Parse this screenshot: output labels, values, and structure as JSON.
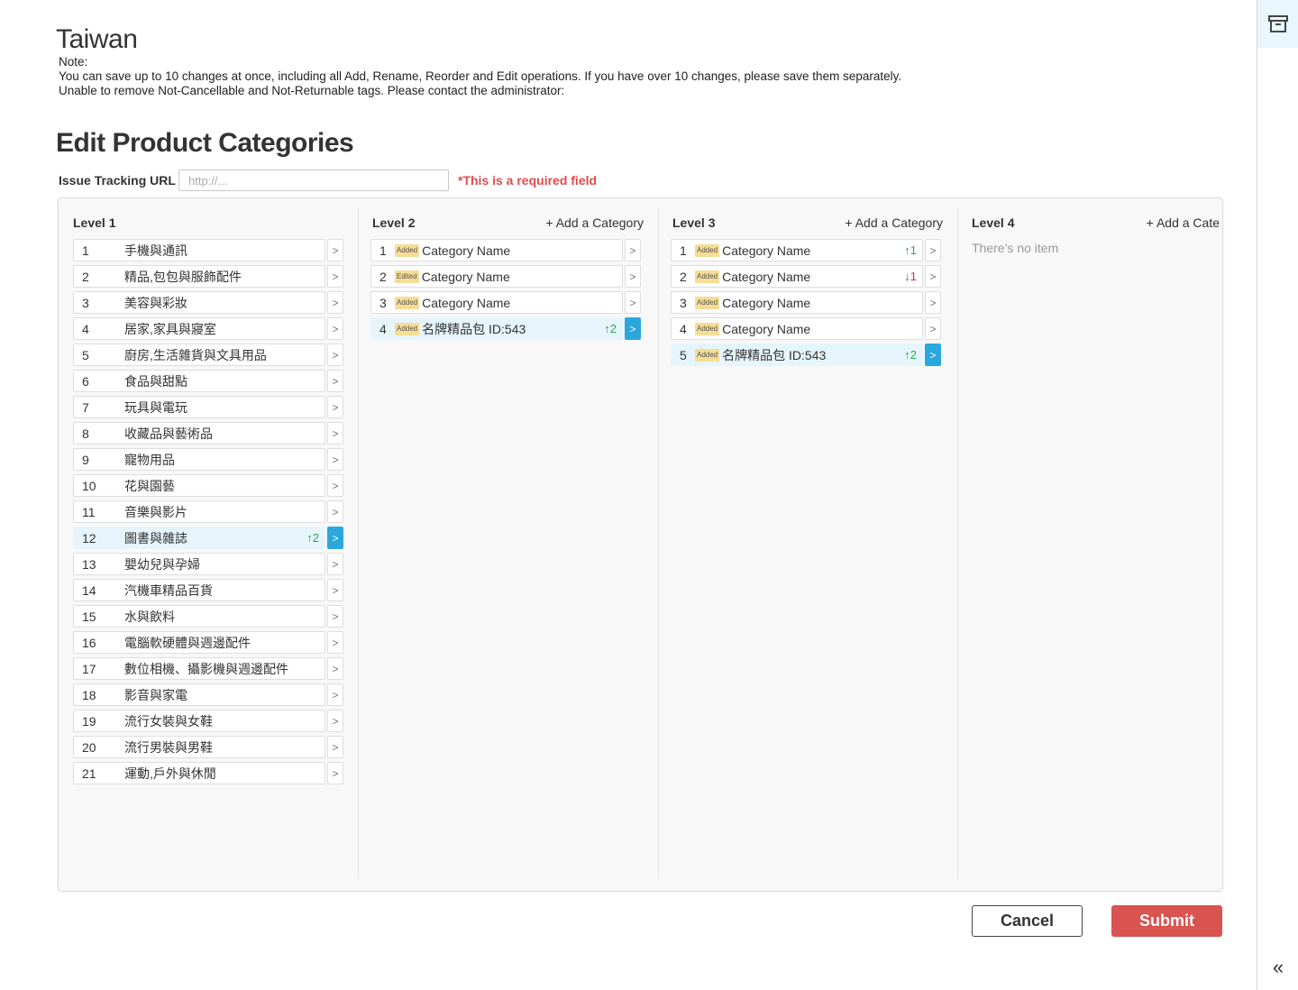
{
  "page": {
    "title": "Taiwan",
    "notes": [
      "Note:",
      "You can save up to 10 changes at once, including all Add, Rename, Reorder and Edit operations. If you have over 10 changes, please save them separately.",
      "Unable to remove Not-Cancellable and Not-Returnable tags. Please contact the administrator:"
    ],
    "section_title": "Edit Product Categories"
  },
  "issue_tracking": {
    "label": "Issue Tracking URL",
    "placeholder": "http://...",
    "value": "",
    "required_text": "*This is a required field"
  },
  "columns": [
    {
      "title": "Level 1",
      "add_label": "",
      "empty_text": "",
      "items": [
        {
          "num": "1",
          "name": "手機與通訊"
        },
        {
          "num": "2",
          "name": "精品,包包與服飾配件"
        },
        {
          "num": "3",
          "name": "美容與彩妝"
        },
        {
          "num": "4",
          "name": "居家,家具與寢室"
        },
        {
          "num": "5",
          "name": "廚房,生活雜貨與文具用品"
        },
        {
          "num": "6",
          "name": "食品與甜點"
        },
        {
          "num": "7",
          "name": "玩具與電玩"
        },
        {
          "num": "8",
          "name": "收藏品與藝術品"
        },
        {
          "num": "9",
          "name": "寵物用品"
        },
        {
          "num": "10",
          "name": "花與園藝"
        },
        {
          "num": "11",
          "name": "音樂與影片"
        },
        {
          "num": "12",
          "name": "圖書與雜誌",
          "move": "↑2",
          "move_dir": "up",
          "active": true
        },
        {
          "num": "13",
          "name": "嬰幼兒與孕婦"
        },
        {
          "num": "14",
          "name": "汽機車精品百貨"
        },
        {
          "num": "15",
          "name": "水與飲料"
        },
        {
          "num": "16",
          "name": "電腦軟硬體與週邊配件"
        },
        {
          "num": "17",
          "name": "數位相機、攝影機與週邊配件"
        },
        {
          "num": "18",
          "name": "影音與家電"
        },
        {
          "num": "19",
          "name": "流行女裝與女鞋"
        },
        {
          "num": "20",
          "name": "流行男裝與男鞋"
        },
        {
          "num": "21",
          "name": "運動,戶外與休閒"
        }
      ]
    },
    {
      "title": "Level 2",
      "add_label": "+ Add a Category",
      "empty_text": "",
      "items": [
        {
          "num": "1",
          "tag": "Added",
          "name": "Category Name"
        },
        {
          "num": "2",
          "tag": "Edited",
          "name": "Category Name"
        },
        {
          "num": "3",
          "tag": "Added",
          "name": "Category Name"
        },
        {
          "num": "4",
          "tag": "Added",
          "name": "名牌精品包 ID:543",
          "move": "↑2",
          "move_dir": "up",
          "active": true
        }
      ]
    },
    {
      "title": "Level 3",
      "add_label": "+ Add a Category",
      "empty_text": "",
      "items": [
        {
          "num": "1",
          "tag": "Added",
          "name": "Category Name",
          "move": "↑1",
          "move_dir": "up"
        },
        {
          "num": "2",
          "tag": "Added",
          "name": "Category Name",
          "move": "↓1",
          "move_dir": "down"
        },
        {
          "num": "3",
          "tag": "Added",
          "name": "Category Name"
        },
        {
          "num": "4",
          "tag": "Added",
          "name": "Category Name"
        },
        {
          "num": "5",
          "tag": "Added",
          "name": "名牌精品包 ID:543",
          "move": "↑2",
          "move_dir": "up",
          "active": true
        }
      ]
    },
    {
      "title": "Level 4",
      "add_label": "+ Add a Cate",
      "empty_text": "There’s no item",
      "items": []
    }
  ],
  "actions": {
    "cancel_label": "Cancel",
    "submit_label": "Submit"
  },
  "icons": {
    "rail_top": "archive-box-icon",
    "rail_bottom": "double-chevron-left-icon",
    "row_arrow": "chevron-right-icon"
  },
  "colors": {
    "accent": "#2aa8de",
    "active_row": "#e6f5fc",
    "submit": "#d9534f",
    "required": "#e04b4b",
    "move_up": "#2ea84a",
    "move_down": "#d83333",
    "tag_bg": "#f5dd96"
  }
}
